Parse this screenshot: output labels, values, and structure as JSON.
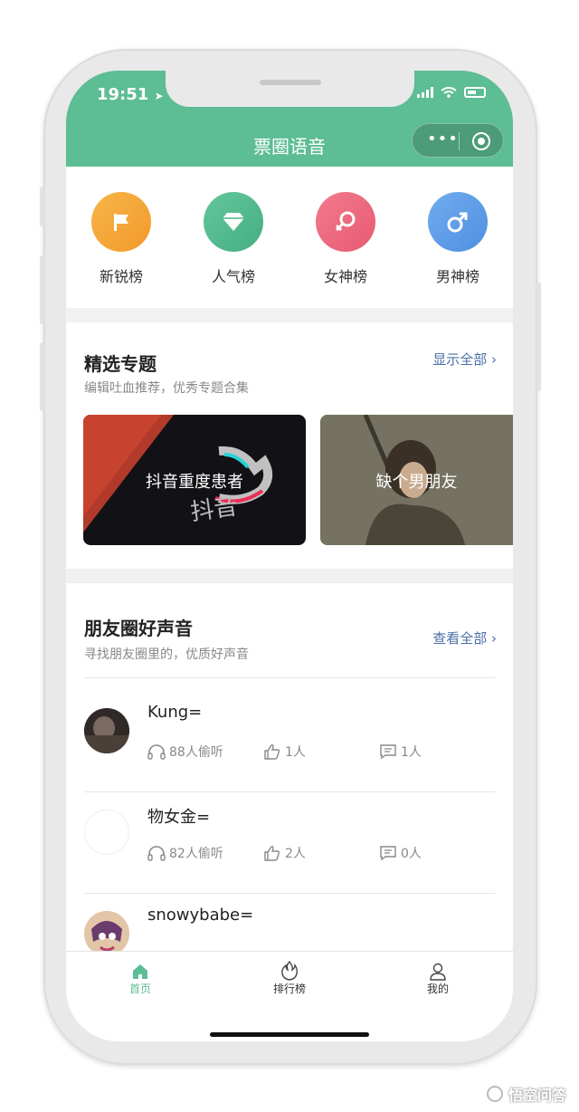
{
  "status": {
    "time": "19:51"
  },
  "header": {
    "title": "票圈语音"
  },
  "categories": [
    {
      "label": "新锐榜",
      "icon": "flag-icon",
      "color": "#f5a93a"
    },
    {
      "label": "人气榜",
      "icon": "diamond-icon",
      "color": "#54b98f"
    },
    {
      "label": "女神榜",
      "icon": "female-icon",
      "color": "#ee6c81"
    },
    {
      "label": "男神榜",
      "icon": "male-icon",
      "color": "#5e9ee9"
    }
  ],
  "topics": {
    "title": "精选专题",
    "subtitle": "编辑吐血推荐，优秀专题合集",
    "more": "显示全部",
    "cards": [
      {
        "title": "抖音重度患者"
      },
      {
        "title": "缺个男朋友"
      }
    ]
  },
  "friends": {
    "title": "朋友圈好声音",
    "subtitle": "寻找朋友圈里的，优质好声音",
    "more": "查看全部",
    "items": [
      {
        "name": "Kung=",
        "listens": "88人偷听",
        "likes": "1人",
        "comments": "1人"
      },
      {
        "name": "物女金=",
        "listens": "82人偷听",
        "likes": "2人",
        "comments": "0人"
      },
      {
        "name": "snowybabe="
      }
    ]
  },
  "tabbar": {
    "tabs": [
      {
        "label": "首页",
        "active": true
      },
      {
        "label": "排行榜"
      },
      {
        "label": "我的"
      }
    ]
  },
  "colors": {
    "accent": "#5dbd94",
    "link": "#4a6fa5"
  },
  "watermark": {
    "text": "悟空问答"
  }
}
